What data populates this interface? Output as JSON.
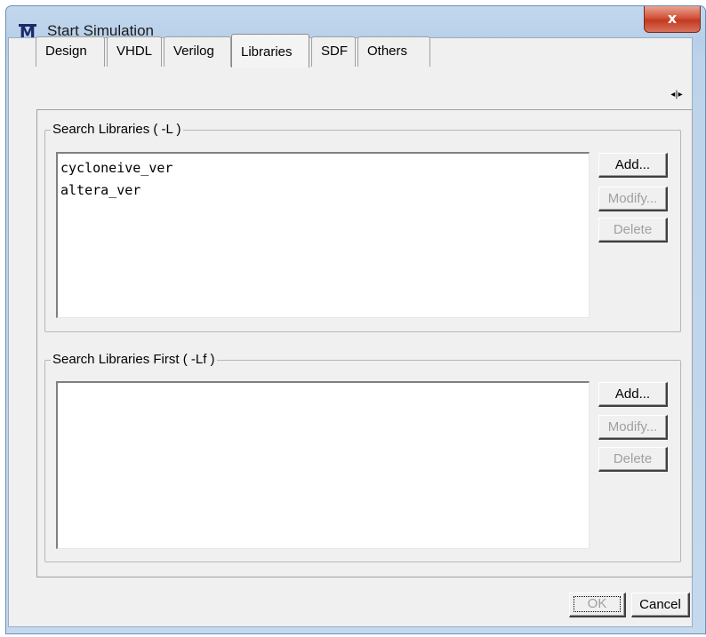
{
  "window": {
    "title": "Start Simulation",
    "app_icon": "M",
    "close_label": "x"
  },
  "tabs": [
    {
      "label": "Design"
    },
    {
      "label": "VHDL"
    },
    {
      "label": "Verilog"
    },
    {
      "label": "Libraries",
      "active": true
    },
    {
      "label": "SDF"
    },
    {
      "label": "Others"
    }
  ],
  "tab_scroll_label": "◂|▸",
  "search_libraries": {
    "label": "Search Libraries ( -L )",
    "items": [
      "cycloneive_ver",
      "altera_ver"
    ],
    "buttons": {
      "add": "Add...",
      "modify": "Modify...",
      "delete": "Delete"
    }
  },
  "search_libraries_first": {
    "label": "Search Libraries First ( -Lf )",
    "items": [],
    "buttons": {
      "add": "Add...",
      "modify": "Modify...",
      "delete": "Delete"
    }
  },
  "footer": {
    "ok_label": "OK",
    "cancel_label": "Cancel"
  }
}
